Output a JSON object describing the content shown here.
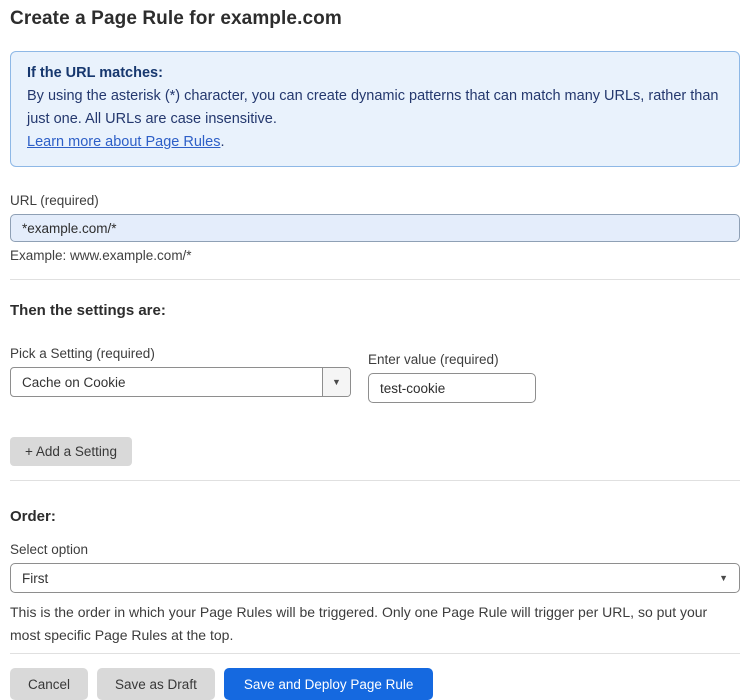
{
  "page": {
    "title": "Create a Page Rule for example.com"
  },
  "info_box": {
    "heading": "If the URL matches:",
    "body": "By using the asterisk (*) character, you can create dynamic patterns that can match many URLs, rather than just one. All URLs are case insensitive.",
    "link_label": "Learn more about Page Rules",
    "link_suffix": "."
  },
  "url_field": {
    "label": "URL (required)",
    "value": "*example.com/*",
    "hint": "Example: www.example.com/*"
  },
  "settings_section": {
    "heading": "Then the settings are:",
    "setting_picker": {
      "label": "Pick a Setting (required)",
      "selected_value": "Cache on Cookie"
    },
    "value_field": {
      "label": "Enter value (required)",
      "value": "test-cookie"
    },
    "add_setting_label": "+ Add a Setting"
  },
  "order_section": {
    "heading": "Order:",
    "select_label": "Select option",
    "selected_option": "First",
    "description": "This is the order in which your Page Rules will be triggered. Only one Page Rule will trigger per URL, so put your most specific Page Rules at the top."
  },
  "actions": {
    "cancel_label": "Cancel",
    "save_draft_label": "Save as Draft",
    "save_deploy_label": "Save and Deploy Page Rule"
  },
  "icons": {
    "dropdown_caret": "▼"
  },
  "colors": {
    "primary_button": "#1569e0",
    "info_box_bg": "#e9f2fc",
    "info_box_border": "#8eb8e6",
    "info_text": "#24386e",
    "link": "#2d5fc7",
    "url_input_bg": "#e4edfb",
    "secondary_button_bg": "#d9d9d9"
  }
}
